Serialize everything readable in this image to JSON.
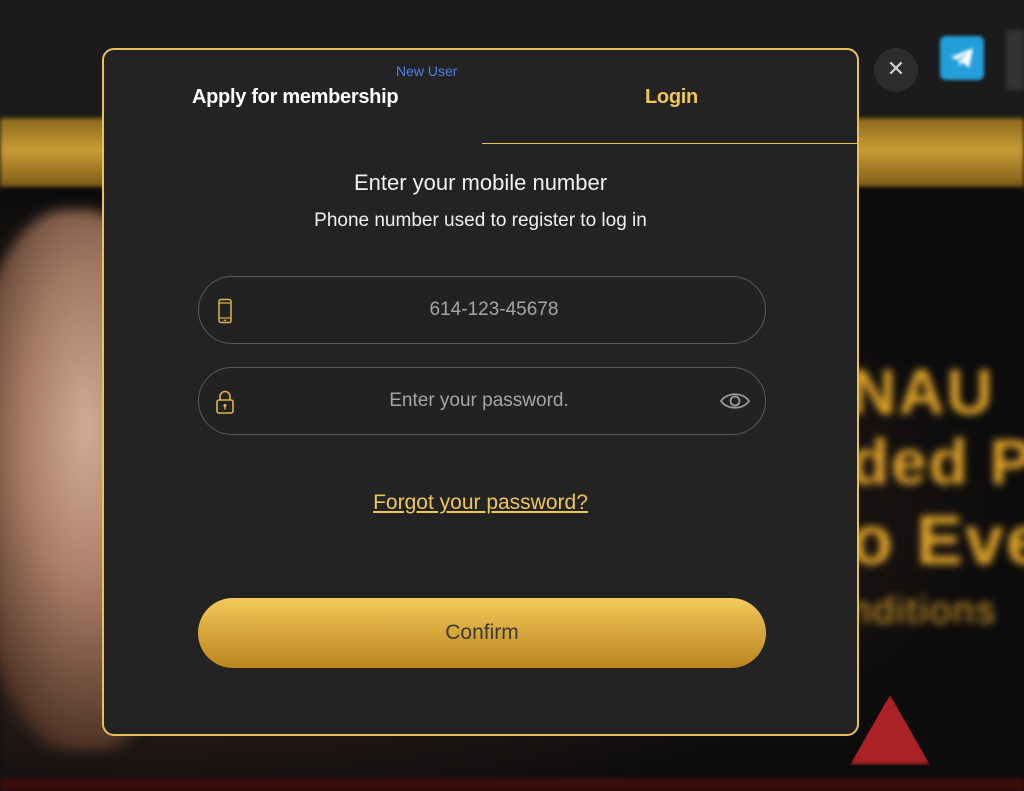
{
  "background": {
    "close_symbol": "✕",
    "banner_lines": [
      "NAU",
      "ded P",
      "o Eve",
      "nditions"
    ]
  },
  "modal": {
    "tabs": {
      "apply_label": "Apply for membership",
      "new_user_badge": "New User",
      "login_label": "Login",
      "active_tab": "Login"
    },
    "heading": "Enter your mobile number",
    "subheading": "Phone number used to register to log in",
    "phone": {
      "placeholder": "614-123-45678",
      "icon": "phone-icon"
    },
    "password": {
      "placeholder": "Enter your password.",
      "icon": "lock-icon",
      "toggle_icon": "eye-icon"
    },
    "forgot_link": "Forgot your password?",
    "confirm_label": "Confirm"
  },
  "colors": {
    "accent_gold": "#f0c656",
    "modal_bg": "#232323",
    "badge_blue": "#4f7fe6"
  }
}
